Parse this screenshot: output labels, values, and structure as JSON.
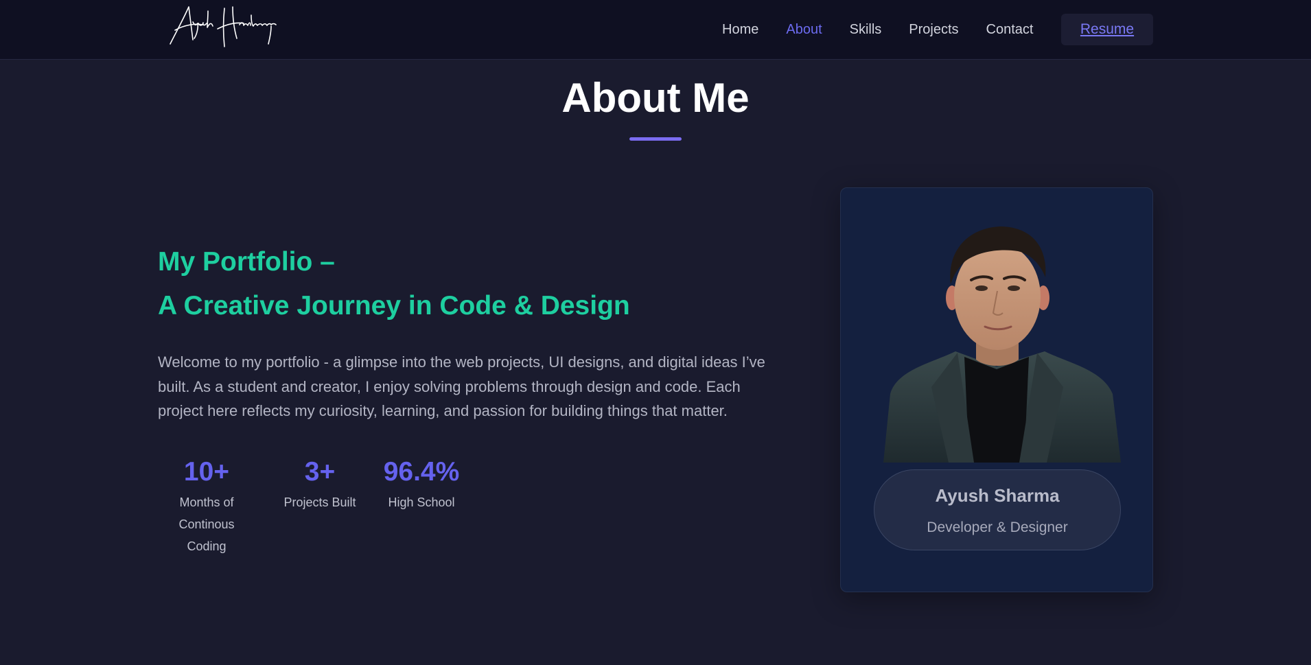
{
  "nav": {
    "logo_text": "Ayush Hardeniya",
    "links": [
      {
        "label": "Home",
        "active": false
      },
      {
        "label": "About",
        "active": true
      },
      {
        "label": "Skills",
        "active": false
      },
      {
        "label": "Projects",
        "active": false
      },
      {
        "label": "Contact",
        "active": false
      }
    ],
    "resume_label": "Resume"
  },
  "about": {
    "title": "About Me",
    "heading_line1": "My Portfolio –",
    "heading_line2": "A Creative Journey in Code & Design",
    "intro": "Welcome to my portfolio - a glimpse into the web projects, UI designs, and digital ideas I’ve built. As a student and creator, I enjoy solving problems through design and code. Each project here reflects my curiosity, learning, and passion for building things that matter.",
    "stats": [
      {
        "value": "10+",
        "label_line1": "Months of",
        "label_line2": "Continous Coding"
      },
      {
        "value": "3+",
        "label_line1": "Projects Built",
        "label_line2": ""
      },
      {
        "value": "96.4%",
        "label_line1": "High School",
        "label_line2": ""
      }
    ]
  },
  "profile": {
    "name": "Ayush Sharma",
    "role": "Developer & Designer"
  },
  "colors": {
    "background": "#1a1b2e",
    "navbar": "#0f1022",
    "accent": "#6562ee",
    "heading": "#1ecfa0",
    "card": "#14203f"
  }
}
